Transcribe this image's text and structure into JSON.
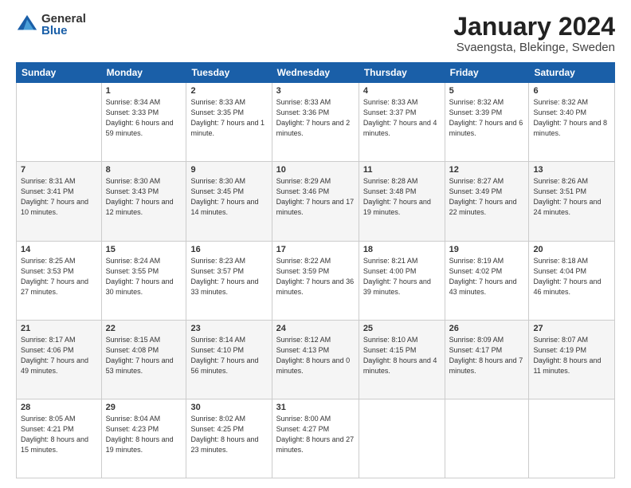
{
  "logo": {
    "general": "General",
    "blue": "Blue"
  },
  "title": "January 2024",
  "location": "Svaengsta, Blekinge, Sweden",
  "weekdays": [
    "Sunday",
    "Monday",
    "Tuesday",
    "Wednesday",
    "Thursday",
    "Friday",
    "Saturday"
  ],
  "weeks": [
    [
      {
        "day": "",
        "sunrise": "",
        "sunset": "",
        "daylight": ""
      },
      {
        "day": "1",
        "sunrise": "Sunrise: 8:34 AM",
        "sunset": "Sunset: 3:33 PM",
        "daylight": "Daylight: 6 hours and 59 minutes."
      },
      {
        "day": "2",
        "sunrise": "Sunrise: 8:33 AM",
        "sunset": "Sunset: 3:35 PM",
        "daylight": "Daylight: 7 hours and 1 minute."
      },
      {
        "day": "3",
        "sunrise": "Sunrise: 8:33 AM",
        "sunset": "Sunset: 3:36 PM",
        "daylight": "Daylight: 7 hours and 2 minutes."
      },
      {
        "day": "4",
        "sunrise": "Sunrise: 8:33 AM",
        "sunset": "Sunset: 3:37 PM",
        "daylight": "Daylight: 7 hours and 4 minutes."
      },
      {
        "day": "5",
        "sunrise": "Sunrise: 8:32 AM",
        "sunset": "Sunset: 3:39 PM",
        "daylight": "Daylight: 7 hours and 6 minutes."
      },
      {
        "day": "6",
        "sunrise": "Sunrise: 8:32 AM",
        "sunset": "Sunset: 3:40 PM",
        "daylight": "Daylight: 7 hours and 8 minutes."
      }
    ],
    [
      {
        "day": "7",
        "sunrise": "Sunrise: 8:31 AM",
        "sunset": "Sunset: 3:41 PM",
        "daylight": "Daylight: 7 hours and 10 minutes."
      },
      {
        "day": "8",
        "sunrise": "Sunrise: 8:30 AM",
        "sunset": "Sunset: 3:43 PM",
        "daylight": "Daylight: 7 hours and 12 minutes."
      },
      {
        "day": "9",
        "sunrise": "Sunrise: 8:30 AM",
        "sunset": "Sunset: 3:45 PM",
        "daylight": "Daylight: 7 hours and 14 minutes."
      },
      {
        "day": "10",
        "sunrise": "Sunrise: 8:29 AM",
        "sunset": "Sunset: 3:46 PM",
        "daylight": "Daylight: 7 hours and 17 minutes."
      },
      {
        "day": "11",
        "sunrise": "Sunrise: 8:28 AM",
        "sunset": "Sunset: 3:48 PM",
        "daylight": "Daylight: 7 hours and 19 minutes."
      },
      {
        "day": "12",
        "sunrise": "Sunrise: 8:27 AM",
        "sunset": "Sunset: 3:49 PM",
        "daylight": "Daylight: 7 hours and 22 minutes."
      },
      {
        "day": "13",
        "sunrise": "Sunrise: 8:26 AM",
        "sunset": "Sunset: 3:51 PM",
        "daylight": "Daylight: 7 hours and 24 minutes."
      }
    ],
    [
      {
        "day": "14",
        "sunrise": "Sunrise: 8:25 AM",
        "sunset": "Sunset: 3:53 PM",
        "daylight": "Daylight: 7 hours and 27 minutes."
      },
      {
        "day": "15",
        "sunrise": "Sunrise: 8:24 AM",
        "sunset": "Sunset: 3:55 PM",
        "daylight": "Daylight: 7 hours and 30 minutes."
      },
      {
        "day": "16",
        "sunrise": "Sunrise: 8:23 AM",
        "sunset": "Sunset: 3:57 PM",
        "daylight": "Daylight: 7 hours and 33 minutes."
      },
      {
        "day": "17",
        "sunrise": "Sunrise: 8:22 AM",
        "sunset": "Sunset: 3:59 PM",
        "daylight": "Daylight: 7 hours and 36 minutes."
      },
      {
        "day": "18",
        "sunrise": "Sunrise: 8:21 AM",
        "sunset": "Sunset: 4:00 PM",
        "daylight": "Daylight: 7 hours and 39 minutes."
      },
      {
        "day": "19",
        "sunrise": "Sunrise: 8:19 AM",
        "sunset": "Sunset: 4:02 PM",
        "daylight": "Daylight: 7 hours and 43 minutes."
      },
      {
        "day": "20",
        "sunrise": "Sunrise: 8:18 AM",
        "sunset": "Sunset: 4:04 PM",
        "daylight": "Daylight: 7 hours and 46 minutes."
      }
    ],
    [
      {
        "day": "21",
        "sunrise": "Sunrise: 8:17 AM",
        "sunset": "Sunset: 4:06 PM",
        "daylight": "Daylight: 7 hours and 49 minutes."
      },
      {
        "day": "22",
        "sunrise": "Sunrise: 8:15 AM",
        "sunset": "Sunset: 4:08 PM",
        "daylight": "Daylight: 7 hours and 53 minutes."
      },
      {
        "day": "23",
        "sunrise": "Sunrise: 8:14 AM",
        "sunset": "Sunset: 4:10 PM",
        "daylight": "Daylight: 7 hours and 56 minutes."
      },
      {
        "day": "24",
        "sunrise": "Sunrise: 8:12 AM",
        "sunset": "Sunset: 4:13 PM",
        "daylight": "Daylight: 8 hours and 0 minutes."
      },
      {
        "day": "25",
        "sunrise": "Sunrise: 8:10 AM",
        "sunset": "Sunset: 4:15 PM",
        "daylight": "Daylight: 8 hours and 4 minutes."
      },
      {
        "day": "26",
        "sunrise": "Sunrise: 8:09 AM",
        "sunset": "Sunset: 4:17 PM",
        "daylight": "Daylight: 8 hours and 7 minutes."
      },
      {
        "day": "27",
        "sunrise": "Sunrise: 8:07 AM",
        "sunset": "Sunset: 4:19 PM",
        "daylight": "Daylight: 8 hours and 11 minutes."
      }
    ],
    [
      {
        "day": "28",
        "sunrise": "Sunrise: 8:05 AM",
        "sunset": "Sunset: 4:21 PM",
        "daylight": "Daylight: 8 hours and 15 minutes."
      },
      {
        "day": "29",
        "sunrise": "Sunrise: 8:04 AM",
        "sunset": "Sunset: 4:23 PM",
        "daylight": "Daylight: 8 hours and 19 minutes."
      },
      {
        "day": "30",
        "sunrise": "Sunrise: 8:02 AM",
        "sunset": "Sunset: 4:25 PM",
        "daylight": "Daylight: 8 hours and 23 minutes."
      },
      {
        "day": "31",
        "sunrise": "Sunrise: 8:00 AM",
        "sunset": "Sunset: 4:27 PM",
        "daylight": "Daylight: 8 hours and 27 minutes."
      },
      {
        "day": "",
        "sunrise": "",
        "sunset": "",
        "daylight": ""
      },
      {
        "day": "",
        "sunrise": "",
        "sunset": "",
        "daylight": ""
      },
      {
        "day": "",
        "sunrise": "",
        "sunset": "",
        "daylight": ""
      }
    ]
  ]
}
